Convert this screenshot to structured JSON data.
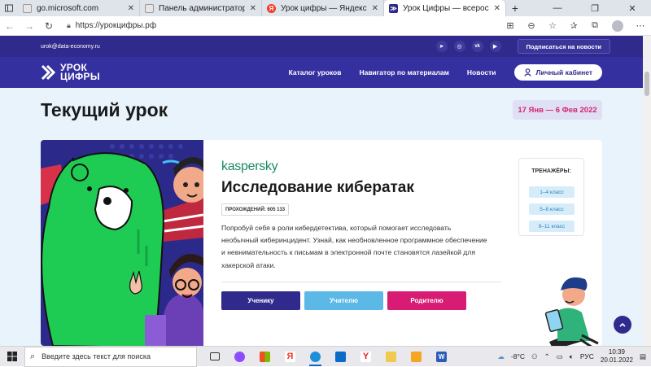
{
  "browser": {
    "tabs": [
      {
        "title": "go.microsoft.com",
        "favicon_color": "#e6e6e6"
      },
      {
        "title": "Панель администратора | EduP",
        "favicon_color": "#e6e6e6"
      },
      {
        "title": "Урок цифры — Яндекс: нашлос",
        "favicon_color": "#f23b26",
        "favicon_glyph": "Я"
      },
      {
        "title": "Урок Цифры — всероссийский",
        "favicon_color": "#2f2a8c",
        "active": true
      }
    ],
    "url": "https://урокцифры.рф",
    "new_tab": "+"
  },
  "site": {
    "email": "urok@data-economy.ru",
    "social_icons": [
      "telegram-icon",
      "odnoklassniki-icon",
      "vk-icon",
      "youtube-icon"
    ],
    "subscribe_label": "Подписаться на новости",
    "logo_line1": "УРОК",
    "logo_line2": "ЦИФРЫ",
    "nav": [
      "Каталог уроков",
      "Навигатор по материалам",
      "Новости"
    ],
    "cabinet_label": "Личный кабинет"
  },
  "main": {
    "title": "Текущий урок",
    "dates": "17 Янв — 6 Фев 2022",
    "lesson": {
      "brand": "kaspersky",
      "title": "Исследование кибератак",
      "passed": "ПРОХОЖДЕНИЙ: 605 133",
      "description": "Попробуй себя в роли кибердетектива, который помогает исследовать необычный киберинцидент. Узнай, как необновленное программное обеспечение и невнимательность к письмам в электронной почте становятся лазейкой для хакерской атаки.",
      "buttons": [
        {
          "label": "Ученику",
          "color": "#2f2a8c"
        },
        {
          "label": "Учителю",
          "color": "#5cb8e6"
        },
        {
          "label": "Родителю",
          "color": "#d81b73"
        }
      ]
    },
    "trainers": {
      "title": "ТРЕНАЖЁРЫ:",
      "grades": [
        "1–4 класс",
        "5–8 класс",
        "9–11 класс"
      ]
    }
  },
  "taskbar": {
    "search_placeholder": "Введите здесь текст для поиска",
    "weather": "-8°C",
    "lang": "РУС",
    "time": "10:39",
    "date": "20.01.2022"
  }
}
